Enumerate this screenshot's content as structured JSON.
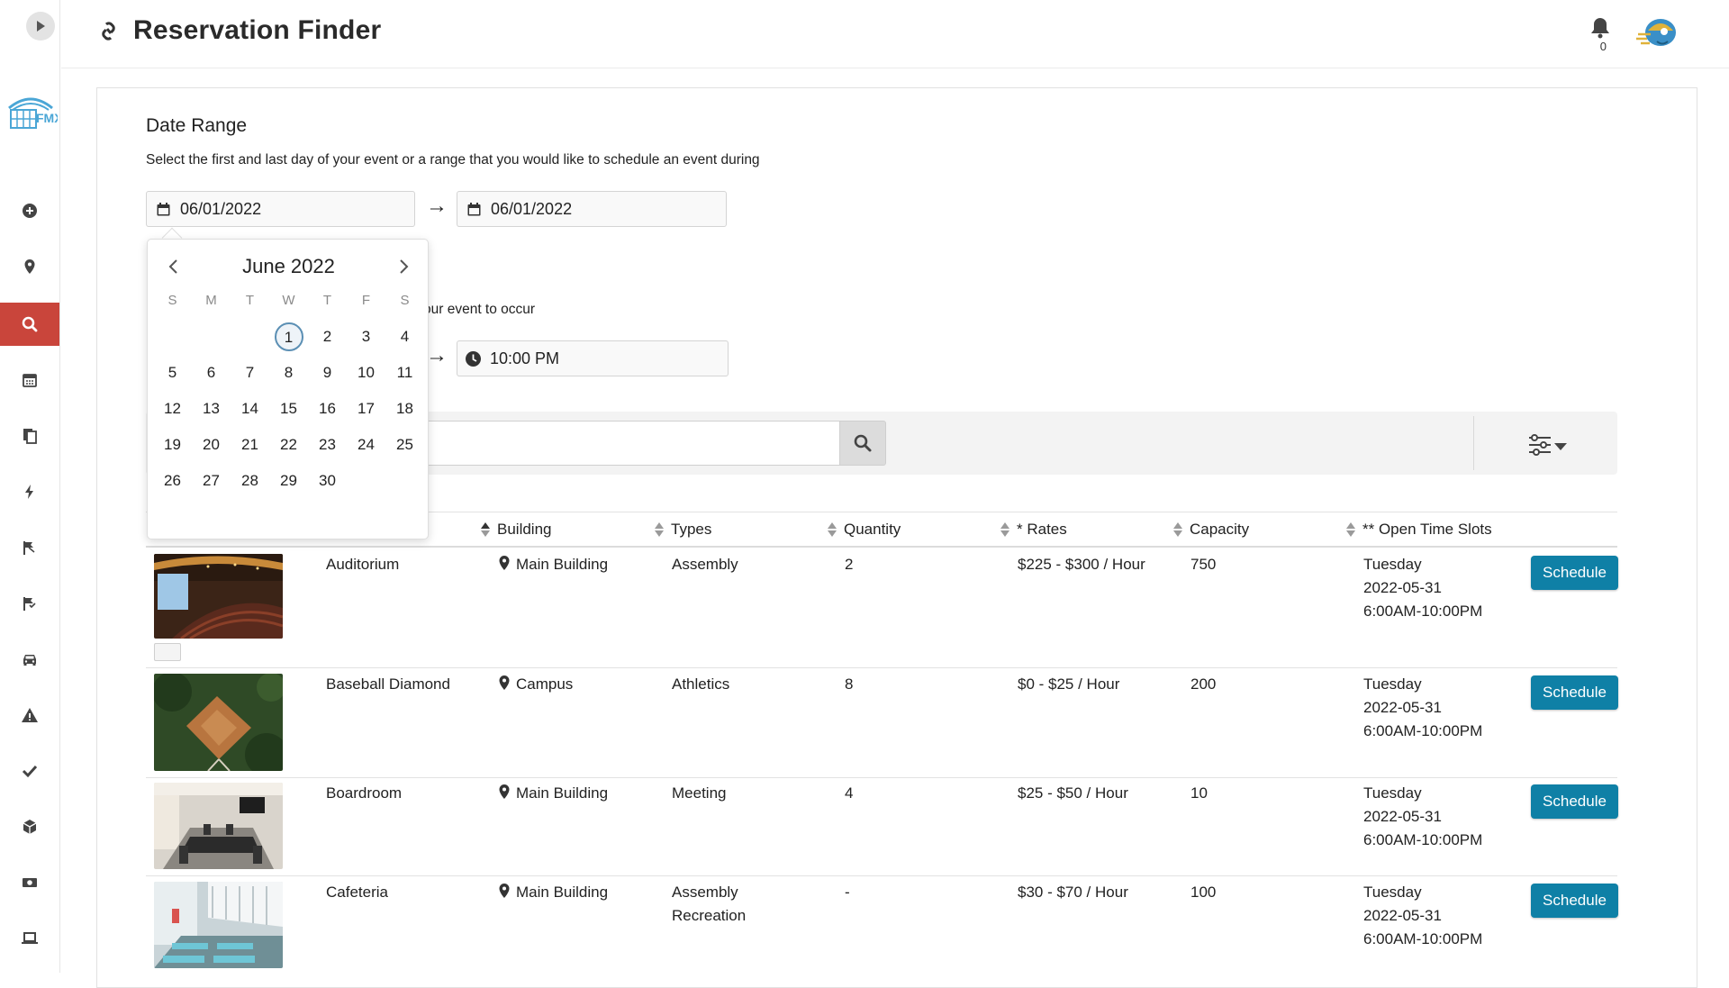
{
  "header": {
    "title": "Reservation Finder",
    "notification_count": "0"
  },
  "sidebar": {
    "items": [
      {
        "name": "add"
      },
      {
        "name": "locations"
      },
      {
        "name": "search",
        "active": true
      },
      {
        "name": "calendar"
      },
      {
        "name": "documents"
      },
      {
        "name": "energy"
      },
      {
        "name": "flag-1"
      },
      {
        "name": "flag-2"
      },
      {
        "name": "vehicles"
      },
      {
        "name": "alerts"
      },
      {
        "name": "tasks"
      },
      {
        "name": "inventory"
      },
      {
        "name": "billing"
      },
      {
        "name": "devices"
      }
    ],
    "accent_color": "#c9453b"
  },
  "date_range": {
    "title": "Date Range",
    "description": "Select the first and last day of your event or a range that you would like to schedule an event during",
    "start_date": "06/01/2022",
    "end_date": "06/01/2022",
    "arrow": "→"
  },
  "time_range": {
    "description_fragment": "our event to occur",
    "end_time": "10:00 PM",
    "arrow": "→"
  },
  "calendar": {
    "month_label": "June 2022",
    "weekdays": [
      "S",
      "M",
      "T",
      "W",
      "T",
      "F",
      "S"
    ],
    "weeks": [
      [
        "",
        "",
        "",
        "1",
        "2",
        "3",
        "4"
      ],
      [
        "5",
        "6",
        "7",
        "8",
        "9",
        "10",
        "11"
      ],
      [
        "12",
        "13",
        "14",
        "15",
        "16",
        "17",
        "18"
      ],
      [
        "19",
        "20",
        "21",
        "22",
        "23",
        "24",
        "25"
      ],
      [
        "26",
        "27",
        "28",
        "29",
        "30",
        "",
        ""
      ]
    ],
    "selected_day": "1"
  },
  "table": {
    "columns": {
      "building": "Building",
      "types": "Types",
      "quantity": "Quantity",
      "rates": "* Rates",
      "capacity": "Capacity",
      "open_slots": "** Open Time Slots"
    },
    "rows": [
      {
        "name": "Auditorium",
        "building": "Main Building",
        "types": [
          "Assembly"
        ],
        "quantity": "2",
        "rates": "$225 - $300 / Hour",
        "capacity": "750",
        "slot_day": "Tuesday",
        "slot_date": "2022-05-31",
        "slot_time": "6:00AM-10:00PM",
        "action": "Schedule"
      },
      {
        "name": "Baseball Diamond",
        "building": "Campus",
        "types": [
          "Athletics"
        ],
        "quantity": "8",
        "rates": "$0 - $25 / Hour",
        "capacity": "200",
        "slot_day": "Tuesday",
        "slot_date": "2022-05-31",
        "slot_time": "6:00AM-10:00PM",
        "action": "Schedule"
      },
      {
        "name": "Boardroom",
        "building": "Main Building",
        "types": [
          "Meeting"
        ],
        "quantity": "4",
        "rates": "$25 - $50 / Hour",
        "capacity": "10",
        "slot_day": "Tuesday",
        "slot_date": "2022-05-31",
        "slot_time": "6:00AM-10:00PM",
        "action": "Schedule"
      },
      {
        "name": "Cafeteria",
        "building": "Main Building",
        "types": [
          "Assembly",
          "Recreation"
        ],
        "quantity": "-",
        "rates": "$30 - $70 / Hour",
        "capacity": "100",
        "slot_day": "Tuesday",
        "slot_date": "2022-05-31",
        "slot_time": "6:00AM-10:00PM",
        "action": "Schedule"
      }
    ]
  },
  "colors": {
    "primary_button": "#0f80a6",
    "active_nav": "#c9453b"
  }
}
